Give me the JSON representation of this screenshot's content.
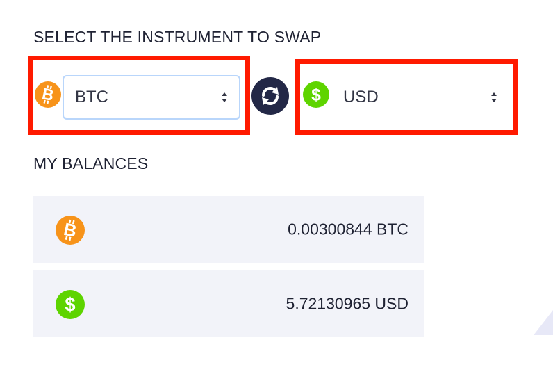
{
  "swap": {
    "title": "SELECT THE INSTRUMENT TO SWAP",
    "from": {
      "value": "BTC",
      "icon": "bitcoin-icon"
    },
    "to": {
      "value": "USD",
      "icon": "dollar-icon"
    },
    "swap_icon": "swap-arrows-icon"
  },
  "balances": {
    "title": "MY BALANCES",
    "items": [
      {
        "icon": "bitcoin-icon",
        "amount": "0.00300844 BTC"
      },
      {
        "icon": "dollar-icon",
        "amount": "5.72130965 USD"
      }
    ]
  },
  "colors": {
    "bitcoin": "#f7931a",
    "dollar": "#5ed400",
    "swap_button": "#232847",
    "highlight": "#ff1a00",
    "card_bg": "#f2f3f9",
    "select_border": "#b9d6fb"
  }
}
